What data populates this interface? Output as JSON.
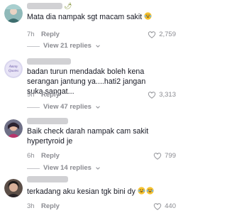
{
  "comments": [
    {
      "username_suffix": "🌶",
      "text": "Mata dia nampak sgt macam sakit",
      "emoji_count": 1,
      "time": "7h",
      "reply_label": "Reply",
      "likes": "2,759",
      "view_replies": "View 21 replies"
    },
    {
      "text": "badan turun mendadak boleh kena serangan jantung ya....hati2 jangan suka sangat...",
      "time": "9h",
      "reply_label": "Reply",
      "likes": "3,313",
      "view_replies": "View 47 replies"
    },
    {
      "text": "Baik check darah nampak cam sakit hypertyroid je",
      "time": "6h",
      "reply_label": "Reply",
      "likes": "799",
      "view_replies": "View 14 replies"
    },
    {
      "text": "terkadang aku kesian tgk bini dy",
      "emoji_count": 2,
      "time": "3h",
      "reply_label": "Reply",
      "likes": "440"
    }
  ],
  "colors": {
    "text": "#161823",
    "muted": "#8a8b91",
    "emoji": "#f5c12e"
  },
  "icons": {
    "like": "heart-outline-icon",
    "expand": "chevron-down-icon",
    "emoji": "crying-laughing-emoji"
  }
}
